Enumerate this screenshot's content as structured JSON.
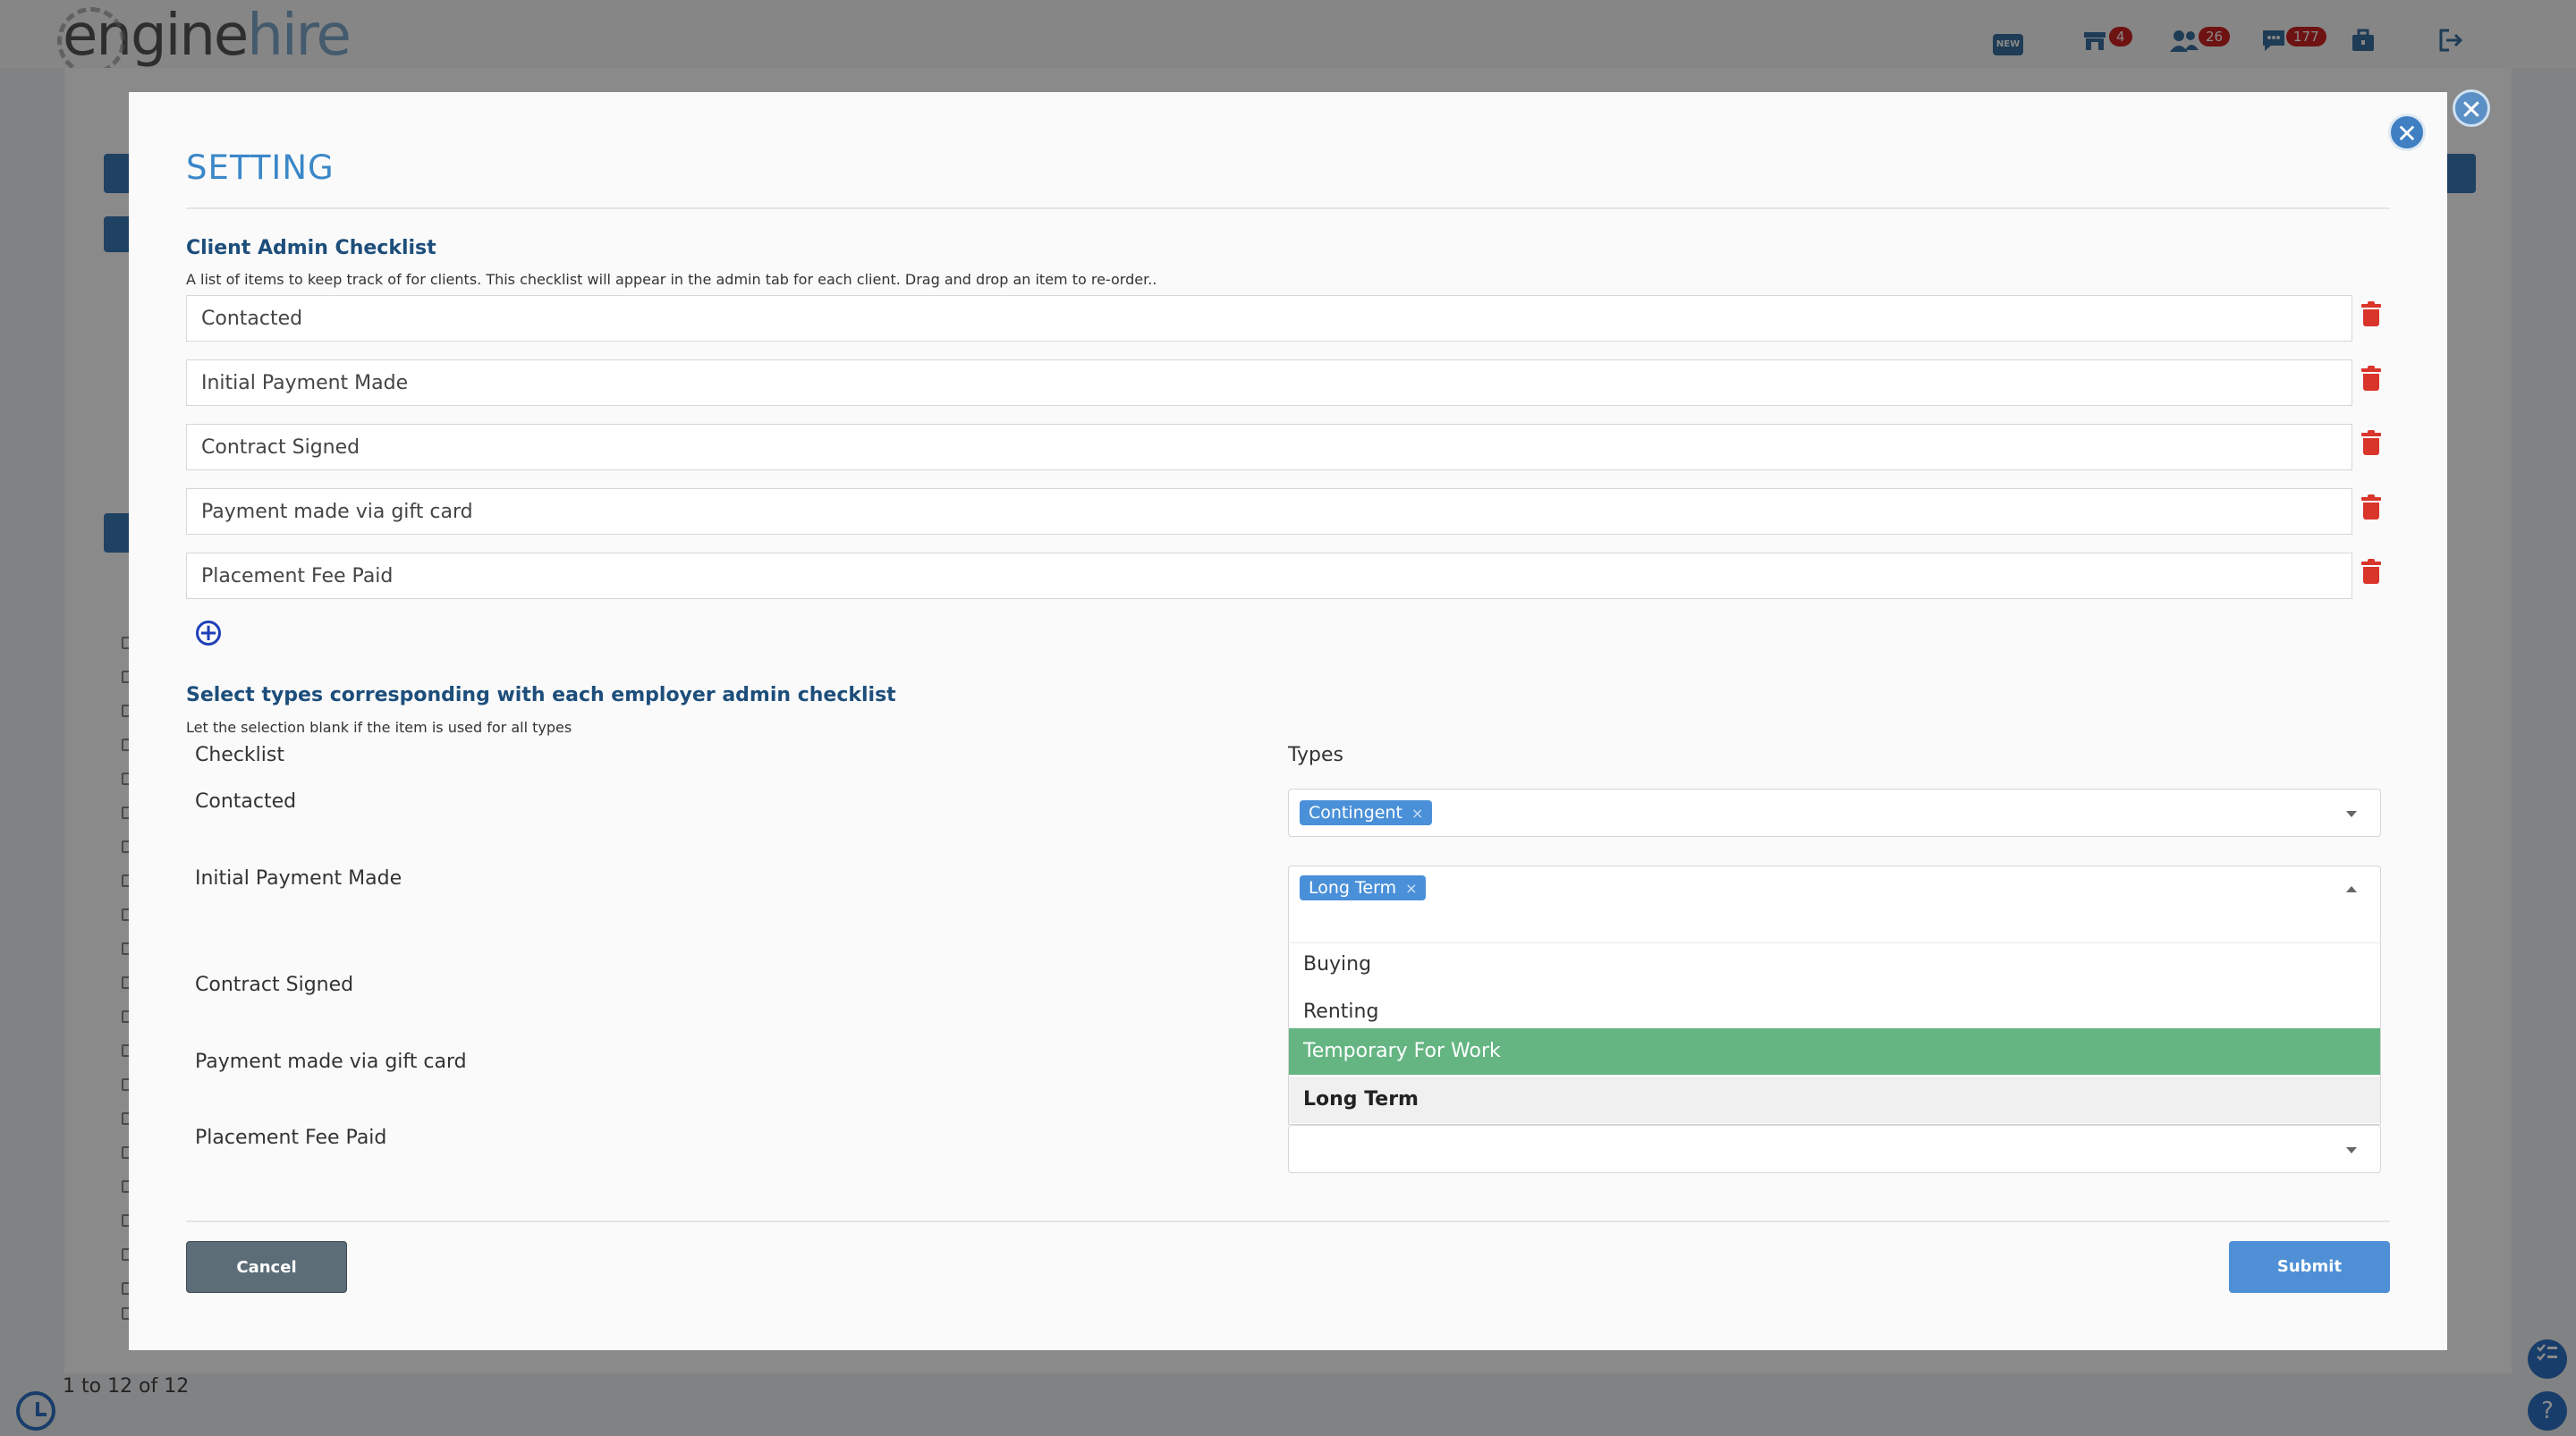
{
  "app": {
    "logo_engine": "engine",
    "logo_hire": "hire",
    "nav": {
      "new_label": "NEW",
      "jobs_badge": "4",
      "users_badge": "26",
      "messages_badge": "177"
    },
    "footer_count": "1 to 12 of 12"
  },
  "modal": {
    "title": "SETTING",
    "close_glyph": "✕",
    "checklist": {
      "title": "Client Admin Checklist",
      "hint": "A list of items to keep track of for clients. This checklist will appear in the admin tab for each client. Drag and drop an item to re-order..",
      "items": [
        {
          "value": "Contacted"
        },
        {
          "value": "Initial Payment Made"
        },
        {
          "value": "Contract Signed"
        },
        {
          "value": "Payment made via gift card"
        },
        {
          "value": "Placement Fee Paid"
        }
      ],
      "add_glyph": "+"
    },
    "types": {
      "title": "Select types corresponding with each employer admin checklist",
      "hint": "Let the selection blank if the item is used for all types",
      "col_checklist": "Checklist",
      "col_types": "Types",
      "rows": [
        {
          "label": "Contacted",
          "chips": [
            "Contingent"
          ]
        },
        {
          "label": "Initial Payment Made",
          "chips": [
            "Long Term"
          ]
        },
        {
          "label": "Contract Signed",
          "chips": []
        },
        {
          "label": "Payment made via gift card",
          "chips": []
        },
        {
          "label": "Placement Fee Paid",
          "chips": []
        }
      ],
      "chip_remove": "×",
      "dropdown_options": [
        {
          "label": "Buying",
          "state": "normal"
        },
        {
          "label": "Renting",
          "state": "normal"
        },
        {
          "label": "Temporary For Work",
          "state": "highlighted"
        },
        {
          "label": "Long Term",
          "state": "selected"
        }
      ]
    },
    "buttons": {
      "cancel": "Cancel",
      "submit": "Submit"
    }
  },
  "colors": {
    "accent": "#3b87c8",
    "section_title": "#1d4e7b",
    "delete": "#d9352a",
    "highlight": "#64b582",
    "chip": "#4a90d9",
    "cancel": "#5c6d78",
    "submit": "#4f8fd6"
  },
  "icons": {
    "new": "new-badge-icon",
    "jobs": "store-icon",
    "users": "users-icon",
    "messages": "chat-icon",
    "briefcase": "briefcase-icon",
    "logout": "logout-icon",
    "delete": "trash-icon",
    "add": "plus-circle-icon",
    "checklist": "checklist-icon",
    "help": "help-icon",
    "clock": "clock-icon"
  }
}
